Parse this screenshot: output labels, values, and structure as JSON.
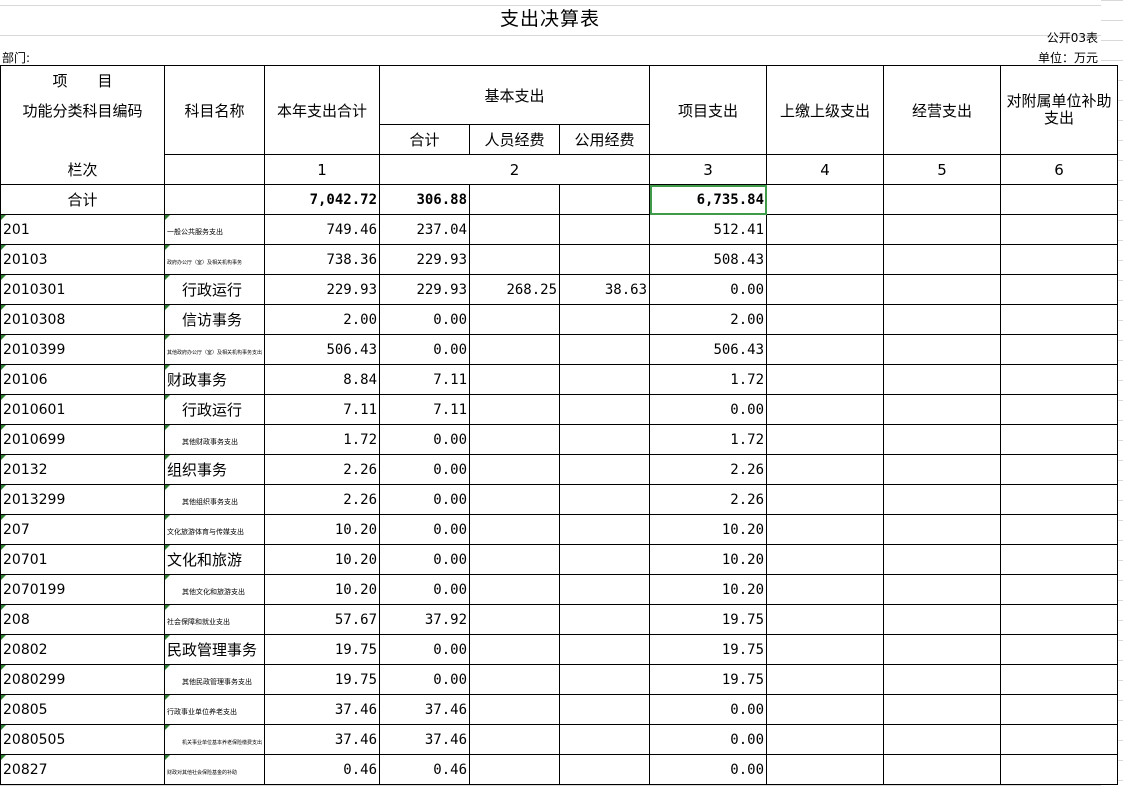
{
  "title": "支出决算表",
  "form_no": "公开03表",
  "dept_label": "部门:",
  "unit_label": "单位：万元",
  "headers": {
    "xiang_mu": "项　　目",
    "func_code": "功能分类科目编码",
    "col_index": "栏次",
    "subject_name": "科目名称",
    "total_year": "本年支出合计",
    "basic": "基本支出",
    "basic_total": "合计",
    "personnel": "人员经费",
    "public": "公用经费",
    "project": "项目支出",
    "upper": "上缴上级支出",
    "operating": "经营支出",
    "subsidy": "对附属单位补助支出",
    "idx1": "1",
    "idx2": "2",
    "idx3": "3",
    "idx4": "4",
    "idx5": "5",
    "idx6": "6"
  },
  "total_row": {
    "label": "合计",
    "year_total": "7,042.72",
    "basic_total": "306.88",
    "project": "6,735.84"
  },
  "rows": [
    {
      "code": "201",
      "name": "一般公共服务支出",
      "name_size": "sm",
      "total": "749.46",
      "basic": "237.04",
      "personnel": "",
      "public": "",
      "project": "512.41"
    },
    {
      "code": "20103",
      "name": "政府办公厅（室）及相关机构事务",
      "name_size": "xs",
      "total": "738.36",
      "basic": "229.93",
      "personnel": "",
      "public": "",
      "project": "508.43"
    },
    {
      "code": "2010301",
      "name": "行政运行",
      "name_size": "lg",
      "indent": true,
      "total": "229.93",
      "basic": "229.93",
      "personnel": "268.25",
      "public": "38.63",
      "project": "0.00"
    },
    {
      "code": "2010308",
      "name": "信访事务",
      "name_size": "lg",
      "indent": true,
      "total": "2.00",
      "basic": "0.00",
      "personnel": "",
      "public": "",
      "project": "2.00"
    },
    {
      "code": "2010399",
      "name": "其他政府办公厅（室）及相关机构事务支出",
      "name_size": "xs",
      "total": "506.43",
      "basic": "0.00",
      "personnel": "",
      "public": "",
      "project": "506.43"
    },
    {
      "code": "20106",
      "name": "财政事务",
      "name_size": "lg",
      "total": "8.84",
      "basic": "7.11",
      "personnel": "",
      "public": "",
      "project": "1.72"
    },
    {
      "code": "2010601",
      "name": "行政运行",
      "name_size": "lg",
      "indent": true,
      "total": "7.11",
      "basic": "7.11",
      "personnel": "",
      "public": "",
      "project": "0.00"
    },
    {
      "code": "2010699",
      "name": "其他财政事务支出",
      "name_size": "sm",
      "indent": true,
      "total": "1.72",
      "basic": "0.00",
      "personnel": "",
      "public": "",
      "project": "1.72"
    },
    {
      "code": "20132",
      "name": "组织事务",
      "name_size": "lg",
      "total": "2.26",
      "basic": "0.00",
      "personnel": "",
      "public": "",
      "project": "2.26"
    },
    {
      "code": "2013299",
      "name": "其他组织事务支出",
      "name_size": "sm",
      "indent": true,
      "total": "2.26",
      "basic": "0.00",
      "personnel": "",
      "public": "",
      "project": "2.26"
    },
    {
      "code": "207",
      "name": "文化旅游体育与传媒支出",
      "name_size": "sm",
      "total": "10.20",
      "basic": "0.00",
      "personnel": "",
      "public": "",
      "project": "10.20"
    },
    {
      "code": "20701",
      "name": "文化和旅游",
      "name_size": "lg",
      "total": "10.20",
      "basic": "0.00",
      "personnel": "",
      "public": "",
      "project": "10.20"
    },
    {
      "code": "2070199",
      "name": "其他文化和旅游支出",
      "name_size": "sm",
      "indent": true,
      "total": "10.20",
      "basic": "0.00",
      "personnel": "",
      "public": "",
      "project": "10.20"
    },
    {
      "code": "208",
      "name": "社会保障和就业支出",
      "name_size": "sm",
      "total": "57.67",
      "basic": "37.92",
      "personnel": "",
      "public": "",
      "project": "19.75"
    },
    {
      "code": "20802",
      "name": "民政管理事务",
      "name_size": "lg",
      "total": "19.75",
      "basic": "0.00",
      "personnel": "",
      "public": "",
      "project": "19.75"
    },
    {
      "code": "2080299",
      "name": "其他民政管理事务支出",
      "name_size": "sm",
      "indent": true,
      "total": "19.75",
      "basic": "0.00",
      "personnel": "",
      "public": "",
      "project": "19.75"
    },
    {
      "code": "20805",
      "name": "行政事业单位养老支出",
      "name_size": "sm",
      "total": "37.46",
      "basic": "37.46",
      "personnel": "",
      "public": "",
      "project": "0.00"
    },
    {
      "code": "2080505",
      "name": "机关事业单位基本养老保险缴费支出",
      "name_size": "xs",
      "indent": true,
      "total": "37.46",
      "basic": "37.46",
      "personnel": "",
      "public": "",
      "project": "0.00"
    },
    {
      "code": "20827",
      "name": "财政对其他社会保险基金的补助",
      "name_size": "xs",
      "total": "0.46",
      "basic": "0.46",
      "personnel": "",
      "public": "",
      "project": "0.00"
    }
  ]
}
